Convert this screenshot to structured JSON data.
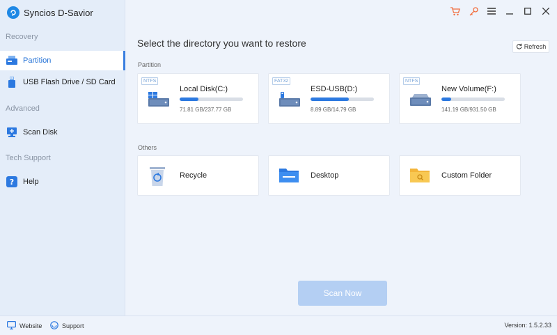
{
  "app": {
    "title": "Syncios D-Savior"
  },
  "sidebar": {
    "sections": [
      {
        "label": "Recovery"
      },
      {
        "label": "Advanced"
      },
      {
        "label": "Tech Support"
      }
    ],
    "items": [
      {
        "label": "Partition",
        "icon": "partition-icon",
        "active": true
      },
      {
        "label": "USB Flash Drive / SD Card",
        "icon": "usb-icon"
      },
      {
        "label": "Scan Disk",
        "icon": "scan-disk-icon"
      },
      {
        "label": "Help",
        "icon": "help-icon"
      }
    ]
  },
  "main": {
    "title": "Select the directory you want to restore",
    "refresh_label": "Refresh",
    "partition_label": "Partition",
    "others_label": "Others",
    "partitions": [
      {
        "fs": "NTFS",
        "name": "Local Disk(C:)",
        "size": "71.81 GB/237.77 GB",
        "used_fraction": 0.302
      },
      {
        "fs": "FAT32",
        "name": "ESD-USB(D:)",
        "size": "8.89 GB/14.79 GB",
        "used_fraction": 0.601
      },
      {
        "fs": "NTFS",
        "name": "New Volume(F:)",
        "size": "141.19 GB/931.50 GB",
        "used_fraction": 0.152
      }
    ],
    "others": [
      {
        "name": "Recycle",
        "icon": "recycle-bin-icon"
      },
      {
        "name": "Desktop",
        "icon": "desktop-folder-icon"
      },
      {
        "name": "Custom Folder",
        "icon": "custom-folder-icon"
      }
    ],
    "scan_button": "Scan Now"
  },
  "footer": {
    "website": "Website",
    "support": "Support",
    "version": "Version: 1.5.2.33"
  },
  "colors": {
    "accent": "#2c79e0",
    "scan_button": "#b4cff3",
    "cart": "#f26d3d"
  }
}
